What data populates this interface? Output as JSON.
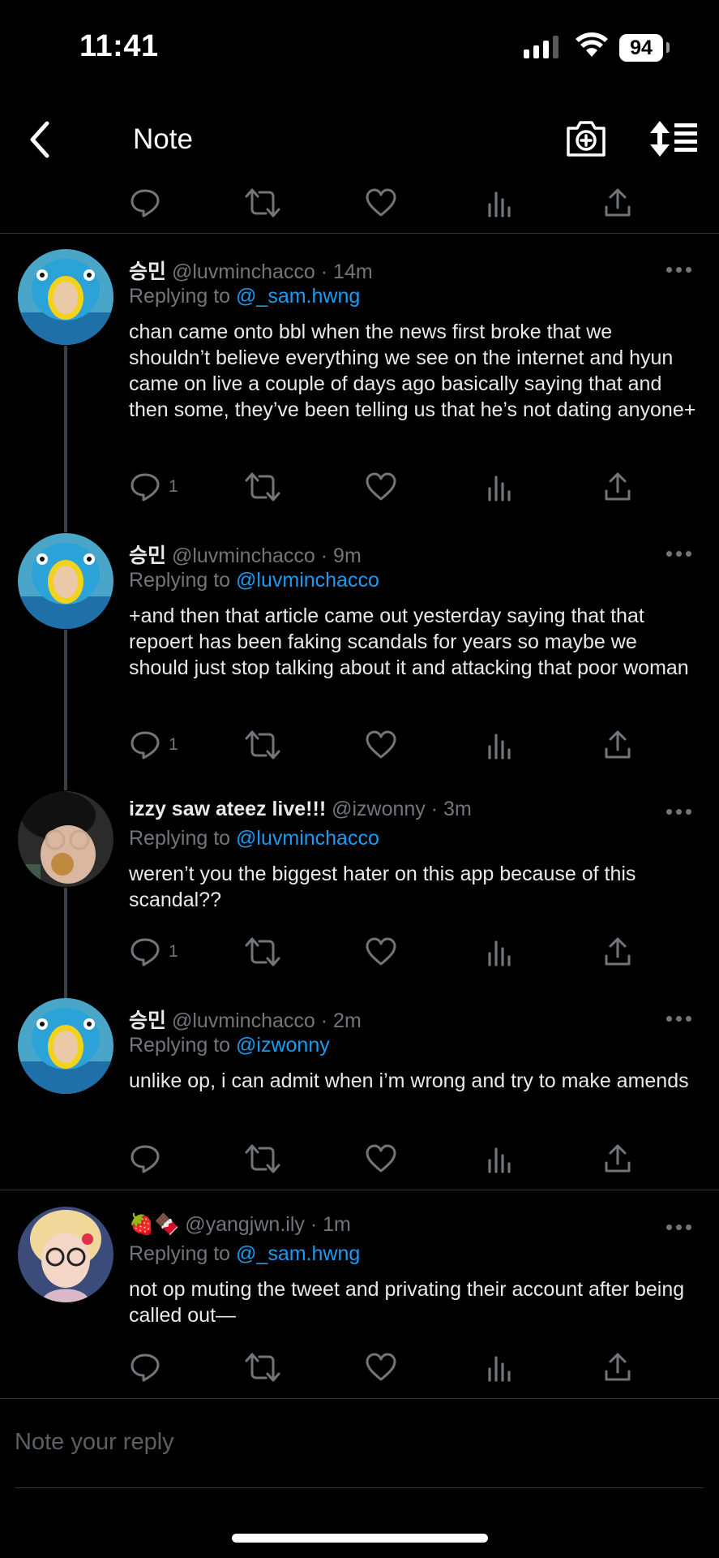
{
  "status_bar": {
    "time": "11:41",
    "battery": "94"
  },
  "nav": {
    "title": "Note"
  },
  "tweets": [
    {
      "name": "승민",
      "handle": "@luvminchacco",
      "age": "14m",
      "replying_label": "Replying to",
      "replying_to": "@_sam.hwng",
      "text": "chan came onto bbl when the news first broke that we shouldn’t believe everything we see on the internet and hyun came on live a couple of days ago basically saying that and then some, they’ve been telling us that he’s not dating anyone+",
      "reply_count": "1"
    },
    {
      "name": "승민",
      "handle": "@luvminchacco",
      "age": "9m",
      "replying_label": "Replying to",
      "replying_to": "@luvminchacco",
      "text": "+and then that article came out yesterday saying that that repoert has been faking scandals for years so maybe we should just stop talking about it and attacking that poor woman",
      "reply_count": "1"
    },
    {
      "name": "izzy saw ateez live!!!",
      "handle": "@izwonny",
      "age": "3m",
      "replying_label": "Replying to",
      "replying_to": "@luvminchacco",
      "text": "weren’t you the biggest hater on this app because of this scandal??",
      "reply_count": "1"
    },
    {
      "name": "승민",
      "handle": "@luvminchacco",
      "age": "2m",
      "replying_label": "Replying to",
      "replying_to": "@izwonny",
      "text": "unlike op, i can admit when i’m wrong and try to make amends",
      "reply_count": ""
    },
    {
      "name": "🍓🍫",
      "handle": "@yangjwn.ily",
      "age": "1m",
      "replying_label": "Replying to",
      "replying_to": "@_sam.hwng",
      "text": "not op muting the tweet and privating their account after being called out—",
      "reply_count": ""
    }
  ],
  "separator": "·",
  "reply_box": {
    "placeholder": "Note your reply"
  },
  "icons": {
    "back": "chevron-left-icon",
    "camera": "camera-plus-icon",
    "sort": "sort-list-icon",
    "reply": "reply-icon",
    "retweet": "retweet-icon",
    "like": "heart-icon",
    "views": "views-icon",
    "share": "share-icon",
    "more": "more-icon"
  },
  "colors": {
    "background": "#000000",
    "link": "#1d9bf0",
    "muted": "#71767b",
    "text": "#e7e9ea"
  }
}
